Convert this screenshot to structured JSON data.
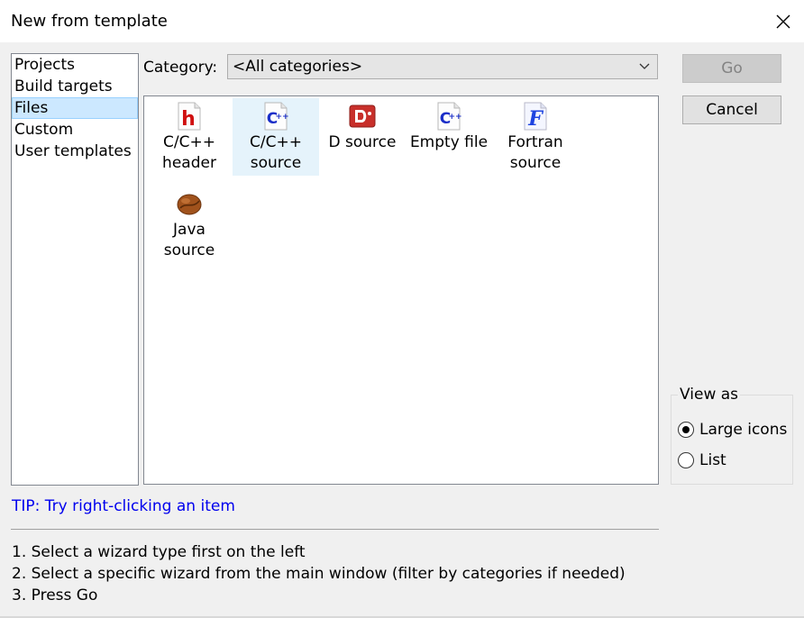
{
  "window": {
    "title": "New from template"
  },
  "wizard_types": [
    {
      "label": "Projects",
      "selected": false
    },
    {
      "label": "Build targets",
      "selected": false
    },
    {
      "label": "Files",
      "selected": true
    },
    {
      "label": "Custom",
      "selected": false
    },
    {
      "label": "User templates",
      "selected": false
    }
  ],
  "category": {
    "label": "Category:",
    "value": "<All categories>"
  },
  "templates": [
    {
      "label": "C/C++\nheader",
      "icon": "c-header-file-icon",
      "selected": false
    },
    {
      "label": "C/C++\nsource",
      "icon": "cpp-source-file-icon",
      "selected": true
    },
    {
      "label": "D source",
      "icon": "d-source-file-icon",
      "selected": false
    },
    {
      "label": "Empty file",
      "icon": "empty-file-icon",
      "selected": false
    },
    {
      "label": "Fortran\nsource",
      "icon": "fortran-file-icon",
      "selected": false
    },
    {
      "label": "Java\nsource",
      "icon": "java-bean-icon",
      "selected": false
    }
  ],
  "buttons": {
    "go": "Go",
    "cancel": "Cancel"
  },
  "view_as": {
    "legend": "View as",
    "options": [
      {
        "label": "Large icons",
        "checked": true
      },
      {
        "label": "List",
        "checked": false
      }
    ]
  },
  "tip": "TIP: Try right-clicking an item",
  "instructions": [
    "1. Select a wizard type first on the left",
    "2. Select a specific wizard from the main window (filter by categories if needed)",
    "3. Press Go"
  ],
  "colors": {
    "tip_text": "#0000ee",
    "selection": "#cce8ff",
    "tile_selection": "#e5f3fb"
  }
}
